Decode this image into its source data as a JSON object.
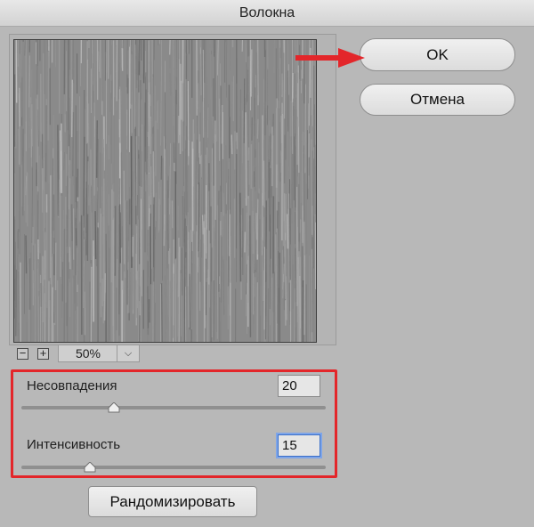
{
  "dialog": {
    "title": "Волокна"
  },
  "buttons": {
    "ok": "OK",
    "cancel": "Отмена",
    "randomize": "Рандомизировать"
  },
  "zoom": {
    "value": "50%",
    "minus_icon": "minus-icon",
    "plus_icon": "plus-icon",
    "dropdown_icon": "chevron-down-icon"
  },
  "params": [
    {
      "label": "Несовпадения",
      "value": "20",
      "slider_fraction": 0.305
    },
    {
      "label": "Интенсивность",
      "value": "15",
      "slider_fraction": 0.225
    }
  ],
  "annotation": {
    "highlight_color": "#e3262a",
    "arrow_color": "#e3262a"
  }
}
